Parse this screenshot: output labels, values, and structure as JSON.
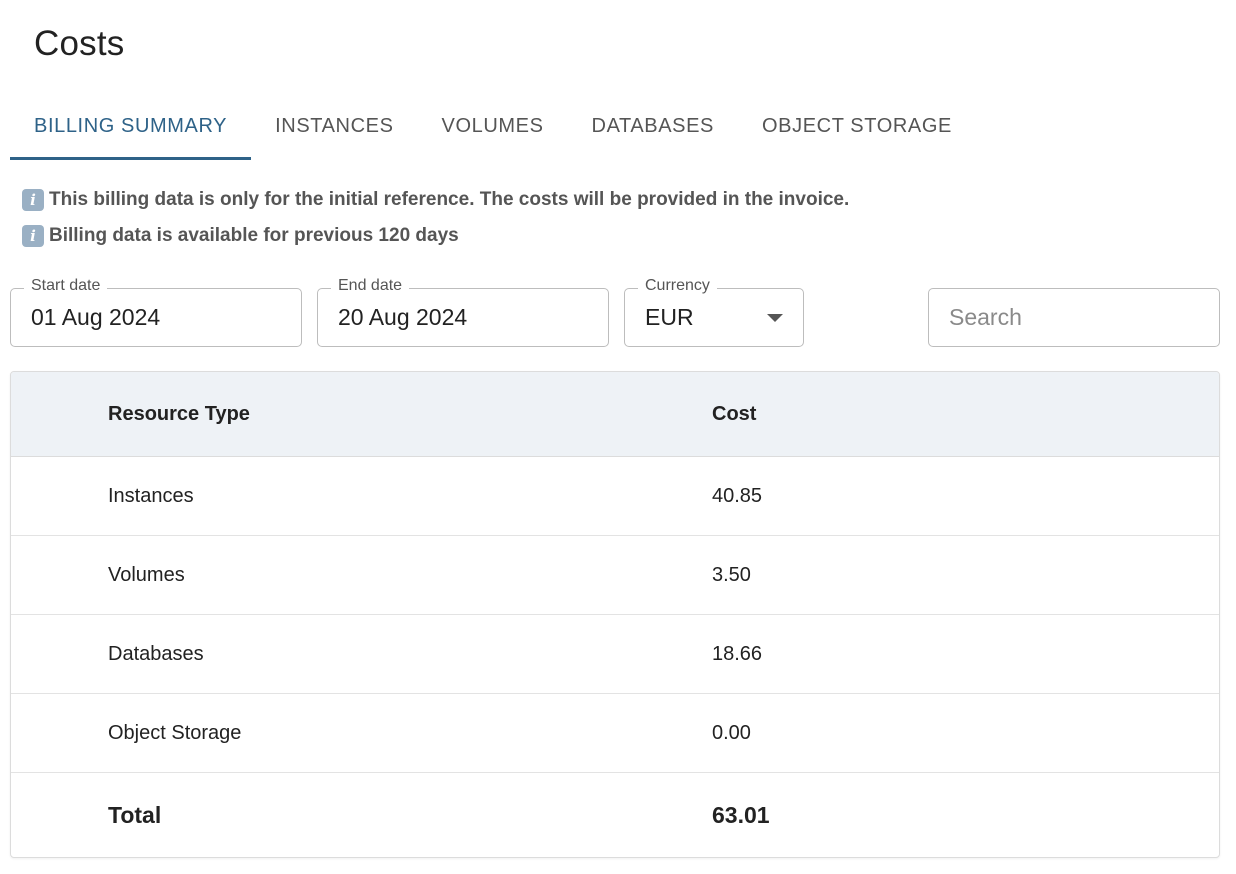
{
  "page": {
    "title": "Costs"
  },
  "tabs": [
    {
      "label": "BILLING SUMMARY",
      "active": true
    },
    {
      "label": "INSTANCES",
      "active": false
    },
    {
      "label": "VOLUMES",
      "active": false
    },
    {
      "label": "DATABASES",
      "active": false
    },
    {
      "label": "OBJECT STORAGE",
      "active": false
    }
  ],
  "notes": [
    {
      "icon": "info-icon",
      "text": "This billing data is only for the initial reference. The costs will be provided in the invoice."
    },
    {
      "icon": "info-icon",
      "text": "Billing data is available for previous 120 days"
    }
  ],
  "filters": {
    "start_date": {
      "label": "Start date",
      "value": "01 Aug 2024"
    },
    "end_date": {
      "label": "End date",
      "value": "20 Aug 2024"
    },
    "currency": {
      "label": "Currency",
      "value": "EUR"
    },
    "search": {
      "placeholder": "Search",
      "value": ""
    }
  },
  "table": {
    "columns": [
      "Resource Type",
      "Cost"
    ],
    "rows": [
      {
        "type": "Instances",
        "cost": "40.85"
      },
      {
        "type": "Volumes",
        "cost": "3.50"
      },
      {
        "type": "Databases",
        "cost": "18.66"
      },
      {
        "type": "Object Storage",
        "cost": "0.00"
      }
    ],
    "total": {
      "label": "Total",
      "cost": "63.01"
    }
  },
  "colors": {
    "accent": "#2e6288",
    "header_bg": "#eef2f6",
    "info_icon_bg": "#9ab0c4"
  }
}
